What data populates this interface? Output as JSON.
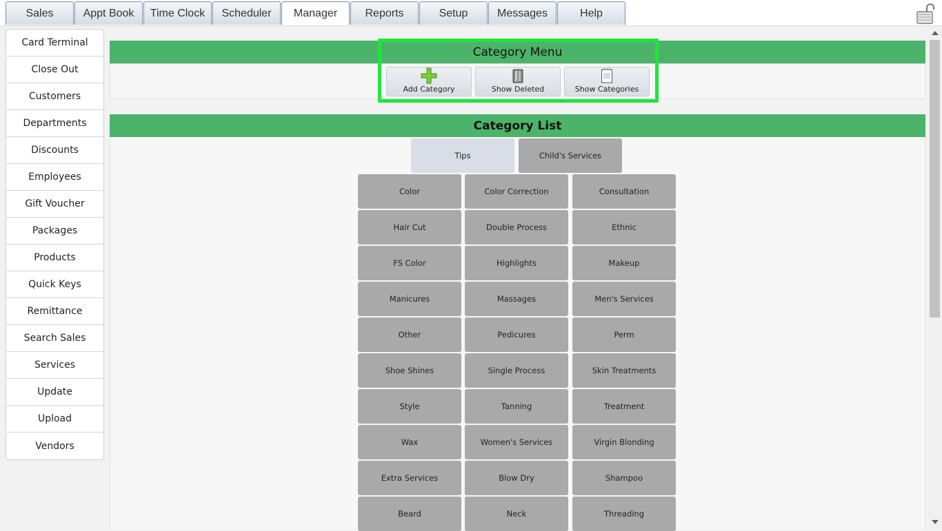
{
  "tabs": [
    "Sales",
    "Appt Book",
    "Time Clock",
    "Scheduler",
    "Manager",
    "Reports",
    "Setup",
    "Messages",
    "Help"
  ],
  "active_tab": "Manager",
  "sidebar": {
    "items": [
      "Card Terminal",
      "Close Out",
      "Customers",
      "Departments",
      "Discounts",
      "Employees",
      "Gift Voucher",
      "Packages",
      "Products",
      "Quick Keys",
      "Remittance",
      "Search Sales",
      "Services",
      "Update",
      "Upload",
      "Vendors"
    ]
  },
  "category_menu": {
    "title": "Category Menu",
    "buttons": [
      {
        "label": "Add Category",
        "icon": "plus-icon"
      },
      {
        "label": "Show Deleted",
        "icon": "trash-icon"
      },
      {
        "label": "Show Categories",
        "icon": "notepad-icon"
      }
    ]
  },
  "category_list": {
    "title": "Category List",
    "top_row": [
      "Tips",
      "Child's Services"
    ],
    "grid": [
      [
        "Color",
        "Color Correction",
        "Consultation"
      ],
      [
        "Hair Cut",
        "Double Process",
        "Ethnic"
      ],
      [
        "FS Color",
        "Highlights",
        "Makeup"
      ],
      [
        "Manicures",
        "Massages",
        "Men's Services"
      ],
      [
        "Other",
        "Pedicures",
        "Perm"
      ],
      [
        "Shoe Shines",
        "Single Process",
        "Skin Treatments"
      ],
      [
        "Style",
        "Tanning",
        "Treatment"
      ],
      [
        "Wax",
        "Women's Services",
        "Virgin Blonding"
      ],
      [
        "Extra Services",
        "Blow Dry",
        "Shampoo"
      ],
      [
        "Beard",
        "Neck",
        "Threading"
      ]
    ]
  },
  "colors": {
    "header_green": "#4cb36a",
    "highlight_green": "#1ee63a",
    "category_gray": "#a9a9a9"
  }
}
